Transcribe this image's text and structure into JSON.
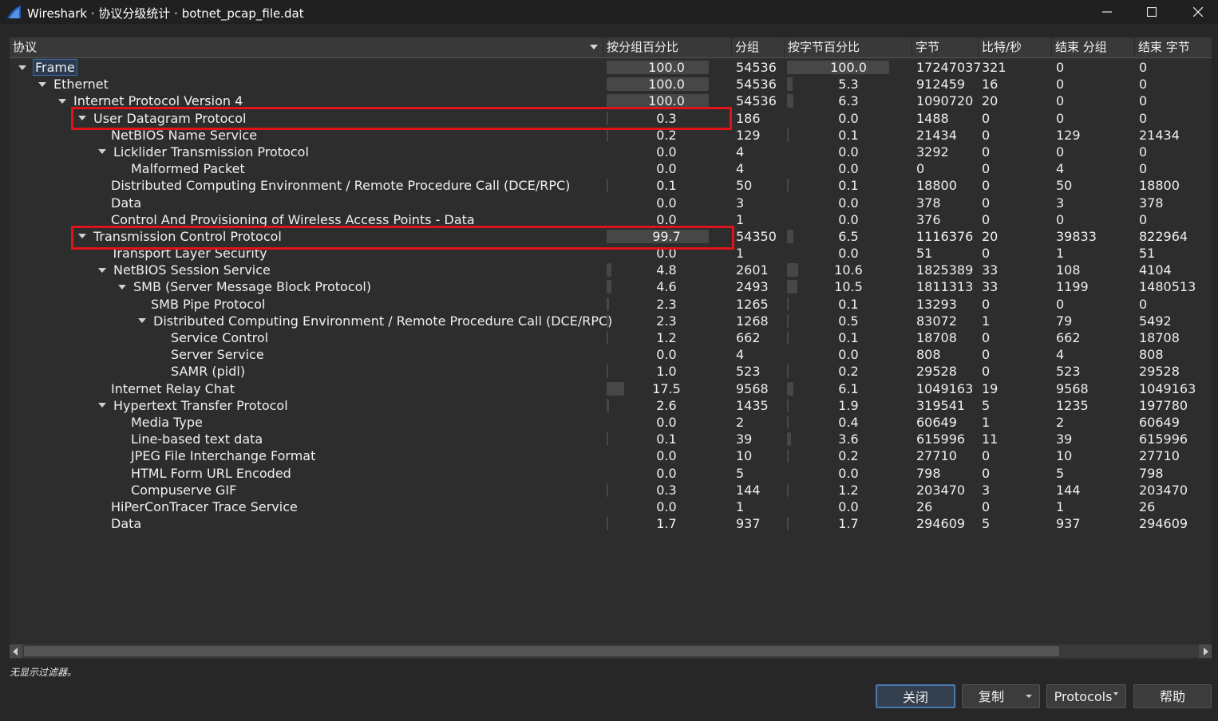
{
  "window": {
    "title": "Wireshark · 协议分级统计 · botnet_pcap_file.dat"
  },
  "columns": [
    "协议",
    "按分组百分比",
    "分组",
    "按字节百分比",
    "字节",
    "比特/秒",
    "结束 分组",
    "结束 字节"
  ],
  "rows": [
    {
      "name": "Frame",
      "level": 0,
      "expanded": true,
      "pct_packets": "100.0",
      "packets": "54536",
      "pct_bytes": "100.0",
      "bytes": "17247037",
      "bits_per_sec": "321",
      "end_packets": "0",
      "end_bytes": "0",
      "selected": true
    },
    {
      "name": "Ethernet",
      "level": 1,
      "expanded": true,
      "pct_packets": "100.0",
      "packets": "54536",
      "pct_bytes": "5.3",
      "bytes": "912459",
      "bits_per_sec": "16",
      "end_packets": "0",
      "end_bytes": "0"
    },
    {
      "name": "Internet Protocol Version 4",
      "level": 2,
      "expanded": true,
      "pct_packets": "100.0",
      "packets": "54536",
      "pct_bytes": "6.3",
      "bytes": "1090720",
      "bits_per_sec": "20",
      "end_packets": "0",
      "end_bytes": "0"
    },
    {
      "name": "User Datagram Protocol",
      "level": 3,
      "expanded": true,
      "pct_packets": "0.3",
      "packets": "186",
      "pct_bytes": "0.0",
      "bytes": "1488",
      "bits_per_sec": "0",
      "end_packets": "0",
      "end_bytes": "0"
    },
    {
      "name": "NetBIOS Name Service",
      "level": 4,
      "expanded": false,
      "pct_packets": "0.2",
      "packets": "129",
      "pct_bytes": "0.1",
      "bytes": "21434",
      "bits_per_sec": "0",
      "end_packets": "129",
      "end_bytes": "21434"
    },
    {
      "name": "Licklider Transmission Protocol",
      "level": 4,
      "expanded": true,
      "pct_packets": "0.0",
      "packets": "4",
      "pct_bytes": "0.0",
      "bytes": "3292",
      "bits_per_sec": "0",
      "end_packets": "0",
      "end_bytes": "0"
    },
    {
      "name": "Malformed Packet",
      "level": 5,
      "expanded": false,
      "pct_packets": "0.0",
      "packets": "4",
      "pct_bytes": "0.0",
      "bytes": "0",
      "bits_per_sec": "0",
      "end_packets": "4",
      "end_bytes": "0"
    },
    {
      "name": "Distributed Computing Environment / Remote Procedure Call (DCE/RPC)",
      "level": 4,
      "expanded": false,
      "pct_packets": "0.1",
      "packets": "50",
      "pct_bytes": "0.1",
      "bytes": "18800",
      "bits_per_sec": "0",
      "end_packets": "50",
      "end_bytes": "18800"
    },
    {
      "name": "Data",
      "level": 4,
      "expanded": false,
      "pct_packets": "0.0",
      "packets": "3",
      "pct_bytes": "0.0",
      "bytes": "378",
      "bits_per_sec": "0",
      "end_packets": "3",
      "end_bytes": "378"
    },
    {
      "name": "Control And Provisioning of Wireless Access Points - Data",
      "level": 4,
      "expanded": false,
      "pct_packets": "0.0",
      "packets": "1",
      "pct_bytes": "0.0",
      "bytes": "376",
      "bits_per_sec": "0",
      "end_packets": "0",
      "end_bytes": "0"
    },
    {
      "name": "Transmission Control Protocol",
      "level": 3,
      "expanded": true,
      "pct_packets": "99.7",
      "packets": "54350",
      "pct_bytes": "6.5",
      "bytes": "1116376",
      "bits_per_sec": "20",
      "end_packets": "39833",
      "end_bytes": "822964"
    },
    {
      "name": "Transport Layer Security",
      "level": 4,
      "expanded": false,
      "pct_packets": "0.0",
      "packets": "1",
      "pct_bytes": "0.0",
      "bytes": "51",
      "bits_per_sec": "0",
      "end_packets": "1",
      "end_bytes": "51"
    },
    {
      "name": "NetBIOS Session Service",
      "level": 4,
      "expanded": true,
      "pct_packets": "4.8",
      "packets": "2601",
      "pct_bytes": "10.6",
      "bytes": "1825389",
      "bits_per_sec": "33",
      "end_packets": "108",
      "end_bytes": "4104"
    },
    {
      "name": "SMB (Server Message Block Protocol)",
      "level": 5,
      "expanded": true,
      "pct_packets": "4.6",
      "packets": "2493",
      "pct_bytes": "10.5",
      "bytes": "1811313",
      "bits_per_sec": "33",
      "end_packets": "1199",
      "end_bytes": "1480513"
    },
    {
      "name": "SMB Pipe Protocol",
      "level": 6,
      "expanded": false,
      "pct_packets": "2.3",
      "packets": "1265",
      "pct_bytes": "0.1",
      "bytes": "13293",
      "bits_per_sec": "0",
      "end_packets": "0",
      "end_bytes": "0"
    },
    {
      "name": "Distributed Computing Environment / Remote Procedure Call (DCE/RPC)",
      "level": 6,
      "expanded": true,
      "pct_packets": "2.3",
      "packets": "1268",
      "pct_bytes": "0.5",
      "bytes": "83072",
      "bits_per_sec": "1",
      "end_packets": "79",
      "end_bytes": "5492"
    },
    {
      "name": "Service Control",
      "level": 7,
      "expanded": false,
      "pct_packets": "1.2",
      "packets": "662",
      "pct_bytes": "0.1",
      "bytes": "18708",
      "bits_per_sec": "0",
      "end_packets": "662",
      "end_bytes": "18708"
    },
    {
      "name": "Server Service",
      "level": 7,
      "expanded": false,
      "pct_packets": "0.0",
      "packets": "4",
      "pct_bytes": "0.0",
      "bytes": "808",
      "bits_per_sec": "0",
      "end_packets": "4",
      "end_bytes": "808"
    },
    {
      "name": "SAMR (pidl)",
      "level": 7,
      "expanded": false,
      "pct_packets": "1.0",
      "packets": "523",
      "pct_bytes": "0.2",
      "bytes": "29528",
      "bits_per_sec": "0",
      "end_packets": "523",
      "end_bytes": "29528"
    },
    {
      "name": "Internet Relay Chat",
      "level": 4,
      "expanded": false,
      "pct_packets": "17.5",
      "packets": "9568",
      "pct_bytes": "6.1",
      "bytes": "1049163",
      "bits_per_sec": "19",
      "end_packets": "9568",
      "end_bytes": "1049163"
    },
    {
      "name": "Hypertext Transfer Protocol",
      "level": 4,
      "expanded": true,
      "pct_packets": "2.6",
      "packets": "1435",
      "pct_bytes": "1.9",
      "bytes": "319541",
      "bits_per_sec": "5",
      "end_packets": "1235",
      "end_bytes": "197780"
    },
    {
      "name": "Media Type",
      "level": 5,
      "expanded": false,
      "pct_packets": "0.0",
      "packets": "2",
      "pct_bytes": "0.4",
      "bytes": "60649",
      "bits_per_sec": "1",
      "end_packets": "2",
      "end_bytes": "60649"
    },
    {
      "name": "Line-based text data",
      "level": 5,
      "expanded": false,
      "pct_packets": "0.1",
      "packets": "39",
      "pct_bytes": "3.6",
      "bytes": "615996",
      "bits_per_sec": "11",
      "end_packets": "39",
      "end_bytes": "615996"
    },
    {
      "name": "JPEG File Interchange Format",
      "level": 5,
      "expanded": false,
      "pct_packets": "0.0",
      "packets": "10",
      "pct_bytes": "0.2",
      "bytes": "27710",
      "bits_per_sec": "0",
      "end_packets": "10",
      "end_bytes": "27710"
    },
    {
      "name": "HTML Form URL Encoded",
      "level": 5,
      "expanded": false,
      "pct_packets": "0.0",
      "packets": "5",
      "pct_bytes": "0.0",
      "bytes": "798",
      "bits_per_sec": "0",
      "end_packets": "5",
      "end_bytes": "798"
    },
    {
      "name": "Compuserve GIF",
      "level": 5,
      "expanded": false,
      "pct_packets": "0.3",
      "packets": "144",
      "pct_bytes": "1.2",
      "bytes": "203470",
      "bits_per_sec": "3",
      "end_packets": "144",
      "end_bytes": "203470"
    },
    {
      "name": "HiPerConTracer Trace Service",
      "level": 4,
      "expanded": false,
      "pct_packets": "0.0",
      "packets": "1",
      "pct_bytes": "0.0",
      "bytes": "26",
      "bits_per_sec": "0",
      "end_packets": "1",
      "end_bytes": "26"
    },
    {
      "name": "Data",
      "level": 4,
      "expanded": false,
      "pct_packets": "1.7",
      "packets": "937",
      "pct_bytes": "1.7",
      "bytes": "294609",
      "bits_per_sec": "5",
      "end_packets": "937",
      "end_bytes": "294609"
    }
  ],
  "status_text": "无显示过滤器。",
  "buttons": {
    "close": "关闭",
    "copy": "复制",
    "protocols": "Protocols",
    "help": "帮助"
  },
  "icons": {
    "app": "wireshark-fin-icon",
    "minimize": "minimize-icon",
    "maximize": "maximize-icon",
    "close": "close-icon"
  },
  "colors": {
    "highlight_box": "#e0121a",
    "app_icon": "#1f5fbf"
  }
}
